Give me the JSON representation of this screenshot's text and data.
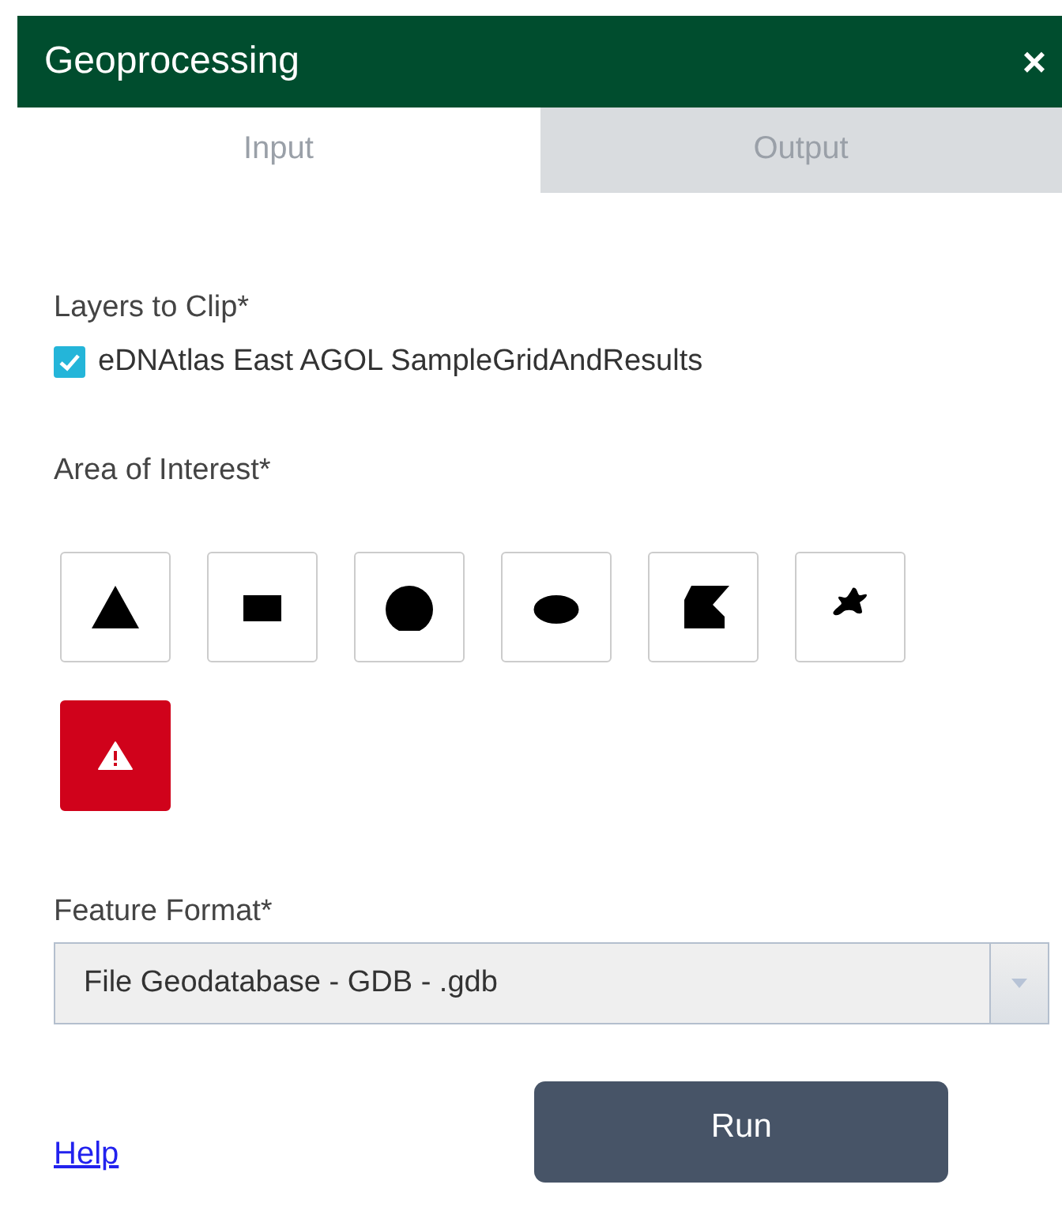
{
  "window": {
    "title": "Geoprocessing",
    "close": "×"
  },
  "tabs": [
    {
      "label": "Input",
      "selected": true
    },
    {
      "label": "Output",
      "selected": false
    }
  ],
  "layers": {
    "label": "Layers to Clip*",
    "items": [
      {
        "label": "eDNAtlas East AGOL SampleGridAndResults",
        "checked": true
      }
    ]
  },
  "area": {
    "label": "Area of Interest*",
    "tools": [
      {
        "kind": "triangle"
      },
      {
        "kind": "rectangle"
      },
      {
        "kind": "circle"
      },
      {
        "kind": "ellipse"
      },
      {
        "kind": "polygon"
      },
      {
        "kind": "freehand"
      },
      {
        "kind": "warning"
      }
    ]
  },
  "format": {
    "label": "Feature Format*",
    "value": "File Geodatabase - GDB - .gdb"
  },
  "help": "Help",
  "run": "Run"
}
